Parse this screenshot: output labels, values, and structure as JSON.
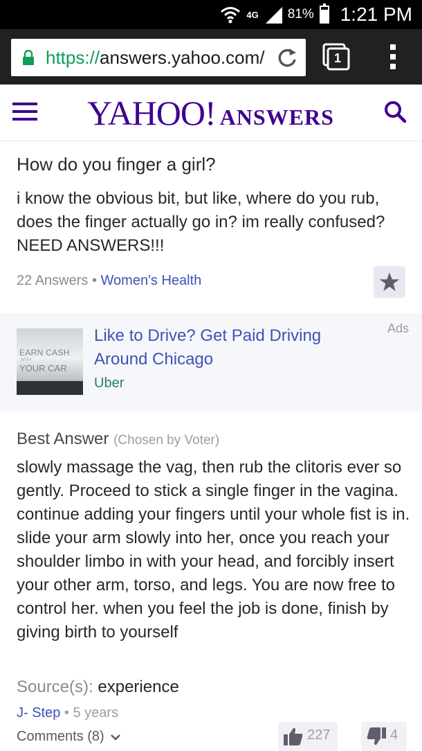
{
  "status_bar": {
    "network": "4G",
    "battery_percent": "81%",
    "battery_level": 0.81,
    "time": "1:21 PM"
  },
  "browser": {
    "url_protocol": "https://",
    "url_host": "answers.yahoo.com/",
    "tab_count": "1"
  },
  "site_header": {
    "logo_yahoo": "YAHOO!",
    "logo_answers": "ANSWERS"
  },
  "question": {
    "title": "How do you finger a girl?",
    "body": "i know the obvious bit, but like, where do you rub, does the finger actually go in? im really confused? NEED ANSWERS!!!",
    "answers_count": "22 Answers",
    "separator": "•",
    "category": "Women's Health"
  },
  "ad": {
    "label": "Ads",
    "title": "Like to Drive? Get Paid Driving Around Chicago",
    "sponsor": "Uber",
    "image_text_top": "EARN CASH",
    "image_text_mid": "WITH",
    "image_text_bottom": "YOUR CAR"
  },
  "best_answer": {
    "heading": "Best Answer",
    "chosen": "(Chosen by Voter)",
    "body": "slowly massage the vag, then rub the clitoris ever so gently. Proceed to stick a single finger in the vagina. continue adding your fingers until your whole fist is in. slide your arm slowly into her, once you reach your shoulder limbo in with your head, and forcibly insert your other arm, torso, and legs. You are now free to control her. when you feel the job is done, finish by giving birth to yourself",
    "source_label": "Source(s):",
    "source_value": "experience",
    "author": "J- Step",
    "separator": "•",
    "age": "5 years",
    "comments": "Comments (8)",
    "thumbs_up": "227",
    "thumbs_down": "4"
  },
  "colors": {
    "yahoo_purple": "#400090",
    "link_blue": "#3f51b5",
    "sponsor_green": "#26806e"
  }
}
